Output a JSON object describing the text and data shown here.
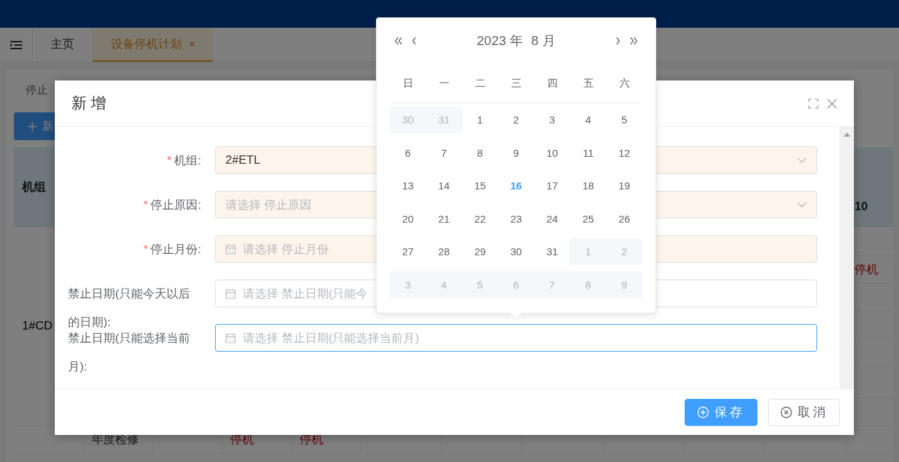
{
  "tabs": [
    {
      "label": "主页",
      "selected": false,
      "closable": false
    },
    {
      "label": "设备停机计划",
      "selected": true,
      "closable": true,
      "close_glyph": "×"
    }
  ],
  "page": {
    "filter_label": "停止",
    "add_button": "新"
  },
  "table": {
    "header_first": "机组",
    "header_last": "10",
    "group_cell": "1#CD",
    "rows": [
      {
        "column_12": {
          "text": "停机",
          "kind": "status"
        }
      },
      {
        "column_2": {
          "text": "年度检修",
          "kind": "plain"
        },
        "column_4": {
          "text": "停机",
          "kind": "status"
        },
        "column_5": {
          "text": "停机",
          "kind": "status"
        }
      }
    ]
  },
  "dialog": {
    "title": "新 增",
    "fields": [
      {
        "label": "机组:",
        "required_mark": "*",
        "kind": "select",
        "value": "2#ETL",
        "focused": false
      },
      {
        "label": "停止原因:",
        "required_mark": "*",
        "kind": "select",
        "placeholder": "请选择 停止原因",
        "focused": false
      },
      {
        "label": "停止月份:",
        "required_mark": "*",
        "kind": "date",
        "placeholder": "请选择 停止月份",
        "focused": false
      },
      {
        "label": "禁止日期(只能今天以后的日期):",
        "kind": "date",
        "placeholder": "请选择 禁止日期(只能今",
        "focused": false
      },
      {
        "label": "禁止日期(只能选择当前月):",
        "kind": "date",
        "placeholder": "请选择 禁止日期(只能选择当前月)",
        "focused": true
      }
    ],
    "buttons": [
      {
        "label": "保存",
        "kind": "primary"
      },
      {
        "label": "取消",
        "kind": "default"
      }
    ]
  },
  "date_picker": {
    "year_label": "2023 年",
    "month_label": "8 月",
    "weekdays": [
      "日",
      "一",
      "二",
      "三",
      "四",
      "五",
      "六"
    ],
    "days": [
      {
        "label": "30",
        "other_month": true,
        "today": false
      },
      {
        "label": "31",
        "other_month": true,
        "today": false
      },
      {
        "label": "1",
        "other_month": false,
        "today": false
      },
      {
        "label": "2",
        "other_month": false,
        "today": false
      },
      {
        "label": "3",
        "other_month": false,
        "today": false
      },
      {
        "label": "4",
        "other_month": false,
        "today": false
      },
      {
        "label": "5",
        "other_month": false,
        "today": false
      },
      {
        "label": "6",
        "other_month": false,
        "today": false
      },
      {
        "label": "7",
        "other_month": false,
        "today": false
      },
      {
        "label": "8",
        "other_month": false,
        "today": false
      },
      {
        "label": "9",
        "other_month": false,
        "today": false
      },
      {
        "label": "10",
        "other_month": false,
        "today": false
      },
      {
        "label": "11",
        "other_month": false,
        "today": false
      },
      {
        "label": "12",
        "other_month": false,
        "today": false
      },
      {
        "label": "13",
        "other_month": false,
        "today": false
      },
      {
        "label": "14",
        "other_month": false,
        "today": false
      },
      {
        "label": "15",
        "other_month": false,
        "today": false
      },
      {
        "label": "16",
        "other_month": false,
        "today": true
      },
      {
        "label": "17",
        "other_month": false,
        "today": false
      },
      {
        "label": "18",
        "other_month": false,
        "today": false
      },
      {
        "label": "19",
        "other_month": false,
        "today": false
      },
      {
        "label": "20",
        "other_month": false,
        "today": false
      },
      {
        "label": "21",
        "other_month": false,
        "today": false
      },
      {
        "label": "22",
        "other_month": false,
        "today": false
      },
      {
        "label": "23",
        "other_month": false,
        "today": false
      },
      {
        "label": "24",
        "other_month": false,
        "today": false
      },
      {
        "label": "25",
        "other_month": false,
        "today": false
      },
      {
        "label": "26",
        "other_month": false,
        "today": false
      },
      {
        "label": "27",
        "other_month": false,
        "today": false
      },
      {
        "label": "28",
        "other_month": false,
        "today": false
      },
      {
        "label": "29",
        "other_month": false,
        "today": false
      },
      {
        "label": "30",
        "other_month": false,
        "today": false
      },
      {
        "label": "31",
        "other_month": false,
        "today": false
      },
      {
        "label": "1",
        "other_month": true,
        "today": false
      },
      {
        "label": "2",
        "other_month": true,
        "today": false
      },
      {
        "label": "3",
        "other_month": true,
        "today": false
      },
      {
        "label": "4",
        "other_month": true,
        "today": false
      },
      {
        "label": "5",
        "other_month": true,
        "today": false
      },
      {
        "label": "6",
        "other_month": true,
        "today": false
      },
      {
        "label": "7",
        "other_month": true,
        "today": false
      },
      {
        "label": "8",
        "other_month": true,
        "today": false
      },
      {
        "label": "9",
        "other_month": true,
        "today": false
      }
    ]
  }
}
